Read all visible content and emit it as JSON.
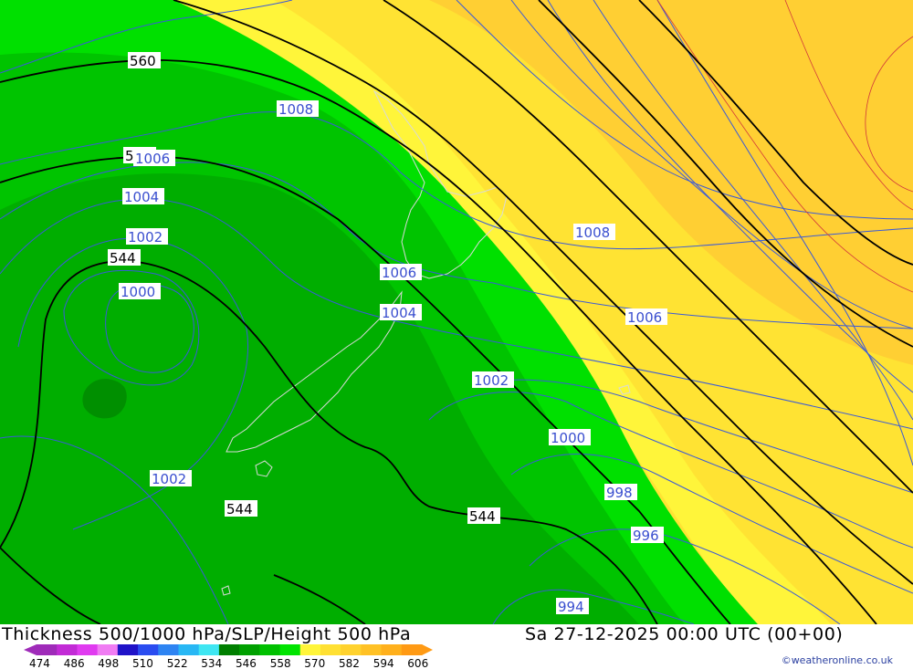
{
  "title": "Thickness 500/1000 hPa/SLP/Height 500 hPa",
  "datetime": "Sa 27-12-2025 00:00 UTC (00+00)",
  "credit": "©weatheronline.co.uk",
  "scale": {
    "labels": [
      "474",
      "486",
      "498",
      "510",
      "522",
      "534",
      "546",
      "558",
      "570",
      "582",
      "594",
      "606"
    ],
    "colors": [
      "#9f2bb9",
      "#c22bd6",
      "#e03bf0",
      "#f07cf3",
      "#1f12c8",
      "#2a4cf0",
      "#2e84f2",
      "#28b7f4",
      "#3fe6f2",
      "#007f00",
      "#00a000",
      "#00c000",
      "#00e400",
      "#fff53a",
      "#ffe033",
      "#ffd22e",
      "#ffc125",
      "#ffb01c",
      "#ff9a14"
    ]
  },
  "map": {
    "thickness_labels": [
      "560",
      "544",
      "544",
      "544",
      "544"
    ],
    "isobar_labels": [
      "1008",
      "1006",
      "1004",
      "1002",
      "1000",
      "1006",
      "1004",
      "1008",
      "1006",
      "1002",
      "1000",
      "998",
      "996",
      "994",
      "1002"
    ]
  }
}
